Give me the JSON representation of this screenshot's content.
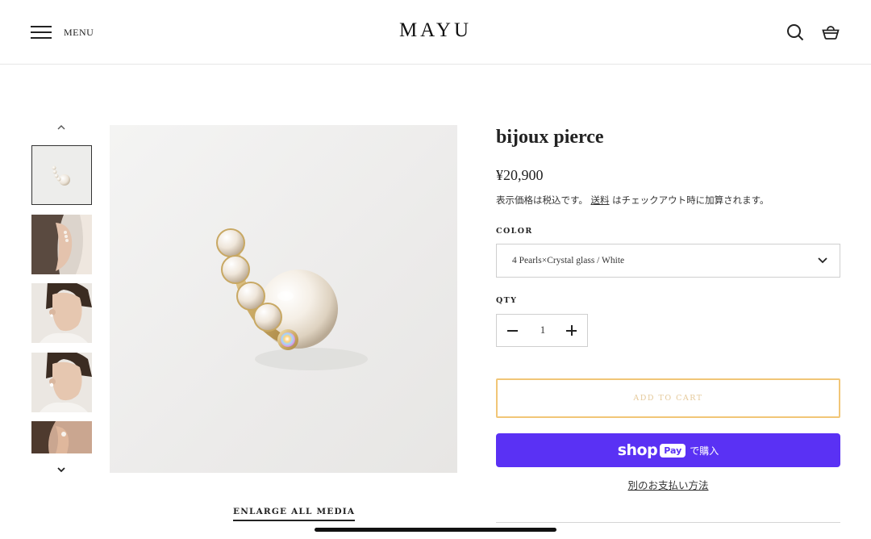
{
  "header": {
    "menu_label": "MENU",
    "logo": "MAYU",
    "icons": [
      "hamburger-icon",
      "search-icon",
      "cart-icon"
    ]
  },
  "gallery": {
    "thumbnail_count": 5,
    "active_index": 0,
    "enlarge_label": "ENLARGE ALL MEDIA"
  },
  "product": {
    "title": "bijoux pierce",
    "price": "¥20,900",
    "tax_note_before": "表示価格は税込です。",
    "tax_note_link": "送料",
    "tax_note_after": "はチェックアウト時に加算されます。",
    "color_label": "COLOR",
    "color_selected": "4 Pearls×Crystal glass / White",
    "qty_label": "QTY",
    "qty_value": "1",
    "add_to_cart": "ADD TO CART",
    "shop_pay_word": "shop",
    "shop_pay_badge": "Pay",
    "shop_pay_suffix": "で購入",
    "more_payment": "別のお支払い方法"
  },
  "colors": {
    "accent_border": "#f1c677",
    "shop_pay": "#5a31f4"
  }
}
